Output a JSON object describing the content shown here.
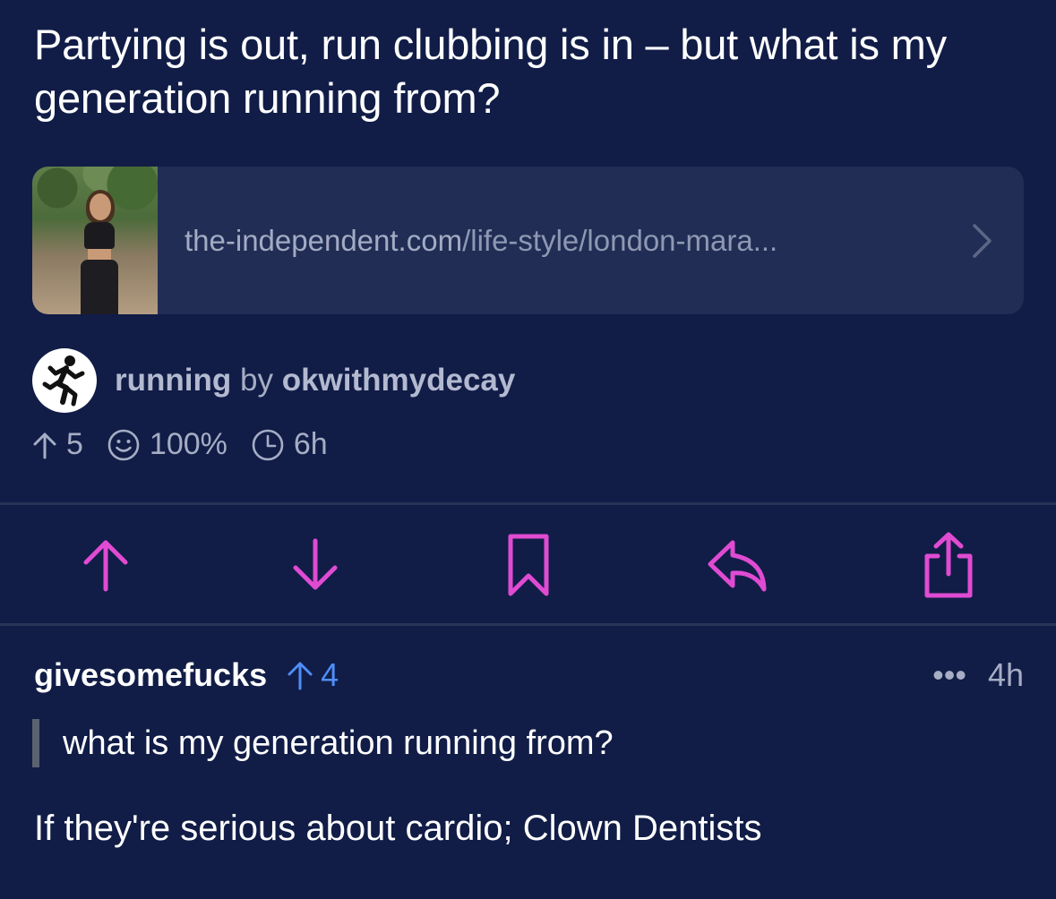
{
  "post": {
    "title": "Partying is out, run clubbing is in – but what is my generation running from?",
    "link": {
      "domain": "the-independent.com",
      "path": "/life-style/london-mara...",
      "thumbnail_icon": "runner-photo"
    },
    "community": "running",
    "by_label": "by",
    "author": "okwithmydecay",
    "stats": {
      "score": "5",
      "upvote_ratio": "100%",
      "age": "6h"
    }
  },
  "actions": {
    "upvote": "upvote-icon",
    "downvote": "downvote-icon",
    "save": "bookmark-icon",
    "reply": "reply-icon",
    "share": "share-icon"
  },
  "comment": {
    "user": "givesomefucks",
    "score": "4",
    "more": "•••",
    "age": "4h",
    "quote": "what is my generation running from?",
    "body": "If they're serious about cardio; Clown Dentists"
  },
  "colors": {
    "background": "#111d47",
    "accent": "#e04bd2",
    "score_blue": "#4f8ef7",
    "muted": "#a6adc4"
  }
}
